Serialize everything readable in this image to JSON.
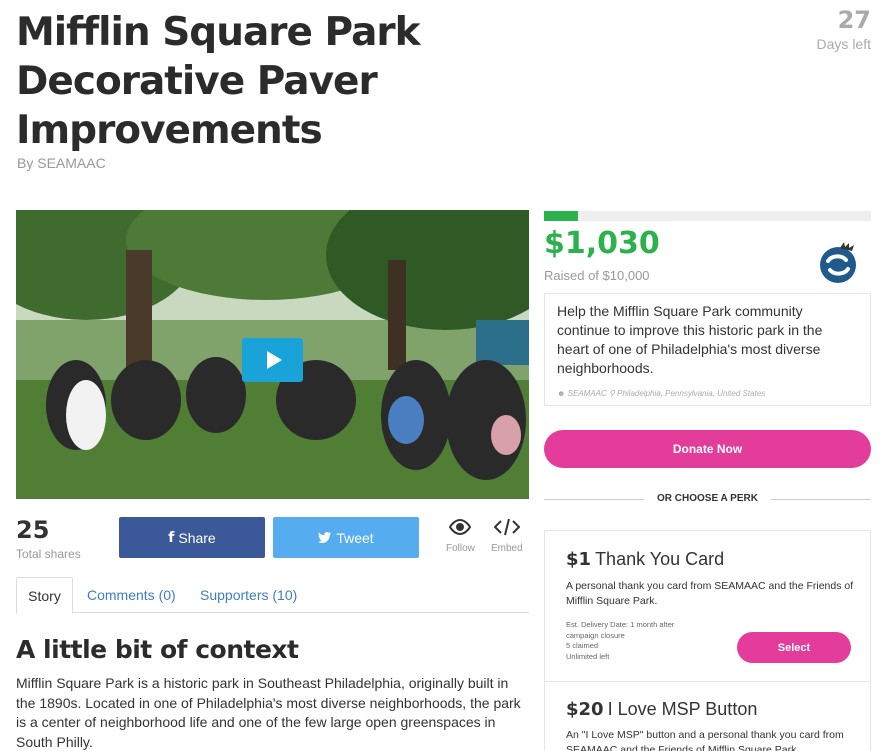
{
  "campaign": {
    "title": "Mifflin Square Park Decorative Paver Improvements",
    "byline": "By SEAMAAC",
    "days_num": "27",
    "days_label": "Days left"
  },
  "share": {
    "total": "25",
    "total_label": "Total shares",
    "facebook_label": "Share",
    "twitter_label": "Tweet",
    "follow_label": "Follow",
    "embed_label": "Embed"
  },
  "tabs": [
    {
      "label": "Story"
    },
    {
      "label": "Comments (0)"
    },
    {
      "label": "Supporters (10)"
    }
  ],
  "story": {
    "heading": "A little bit of context",
    "body": "Mifflin Square Park is a historic park in Southeast Philadelphia, originally built in the 1890s. Located in one of Philadelphia's most diverse neighborhoods, the park is a center of neighborhood life and one of the few large open greenspaces in South Philly."
  },
  "funding": {
    "raised": "$1,030",
    "goal": "Raised of $10,000",
    "progress_fraction": 0.103,
    "description": "Help the Mifflin Square Park community continue to improve this historic park in the heart of one of Philadelphia's most diverse neighborhoods.",
    "owner": "SEAMAAC",
    "location": "Philadelphia, Pennsylvania, United States",
    "donate_label": "Donate Now",
    "perk_divider": "OR CHOOSE A PERK"
  },
  "perks": [
    {
      "amount": "$1",
      "name": "Thank You Card",
      "description": "A personal thank you card from SEAMAAC and the Friends of Mifflin Square Park.",
      "delivery": "Est. Delivery Date: 1 month after campaign closure",
      "claimed": "5 claimed",
      "limit": "Unlimited left",
      "select_label": "Select"
    },
    {
      "amount": "$20",
      "name": "I Love MSP Button",
      "description": "An \"I Love MSP\" button and a personal thank you card from SEAMAAC and the Friends of Mifflin Square Park."
    }
  ],
  "colors": {
    "brand_pink": "#e43c9a",
    "progress_green": "#2bb24c",
    "facebook": "#3b5998",
    "twitter": "#55acee",
    "link_blue": "#3f7fbf"
  },
  "icons": [
    "facebook-icon",
    "twitter-icon",
    "eye-icon",
    "code-icon",
    "play-icon",
    "user-icon",
    "map-pin-icon"
  ]
}
